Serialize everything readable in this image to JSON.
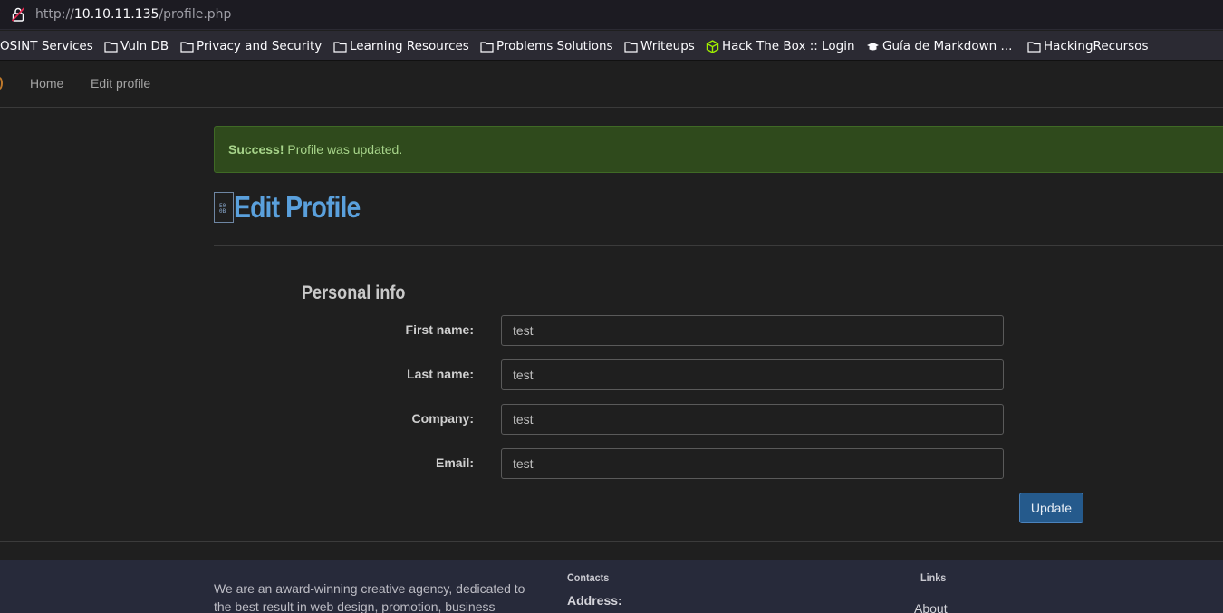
{
  "browser": {
    "url_scheme": "http://",
    "url_host": "10.10.11.135",
    "url_path": "/profile.php",
    "bookmarks": [
      {
        "label": "OSINT Services",
        "icon": "folder-icon"
      },
      {
        "label": "Vuln DB",
        "icon": "folder-icon"
      },
      {
        "label": "Privacy and Security",
        "icon": "folder-icon"
      },
      {
        "label": "Learning Resources",
        "icon": "folder-icon"
      },
      {
        "label": "Problems Solutions",
        "icon": "folder-icon"
      },
      {
        "label": "Writeups",
        "icon": "folder-icon"
      },
      {
        "label": "Hack The Box :: Login",
        "icon": "htb-cube-icon"
      },
      {
        "label": "Guía de Markdown ...",
        "icon": "graduation-cap-icon"
      },
      {
        "label": "HackingRecursos",
        "icon": "folder-icon"
      }
    ]
  },
  "nav": {
    "home": "Home",
    "edit_profile": "Edit profile"
  },
  "alert": {
    "strong": "Success!",
    "message": " Profile was updated."
  },
  "page": {
    "broken_image_glyph": "E0 0B",
    "title": "Edit Profile",
    "section_title": "Personal info"
  },
  "form": {
    "fields": [
      {
        "label": "First name:",
        "value": "test"
      },
      {
        "label": "Last name:",
        "value": "test"
      },
      {
        "label": "Company:",
        "value": "test"
      },
      {
        "label": "Email:",
        "value": "test"
      }
    ],
    "submit_label": "Update"
  },
  "footer": {
    "about_text": "We are an award-winning creative agency, dedicated to the best result in web design, promotion, business",
    "contacts_heading": "Contacts",
    "address_label": "Address:",
    "links_heading": "Links",
    "about_link": "About"
  },
  "colors": {
    "accent_title": "#5aa0dc",
    "success_bg": "#2f4a1c",
    "button_bg": "#255a8c"
  }
}
